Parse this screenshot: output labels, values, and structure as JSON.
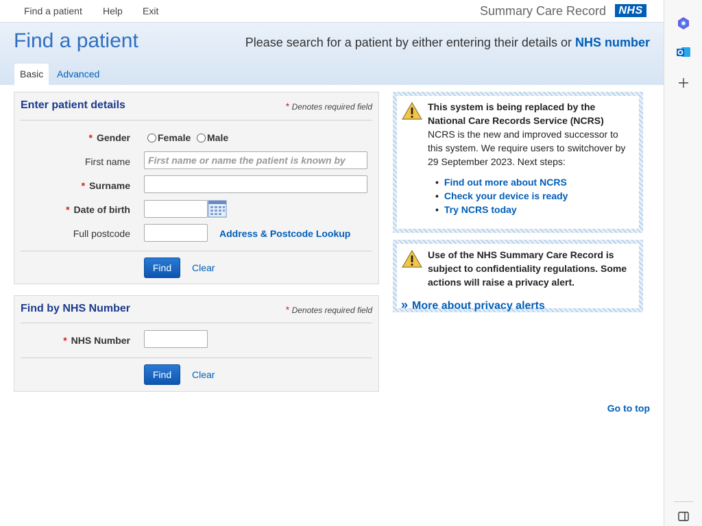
{
  "nav": {
    "find_patient": "Find a patient",
    "help": "Help",
    "exit": "Exit",
    "brand": "Summary Care Record",
    "logo_text": "NHS"
  },
  "header": {
    "title": "Find a patient",
    "intro_text": "Please search for a patient by either entering their details or",
    "intro_link": "NHS number",
    "tabs": [
      {
        "label": "Basic",
        "active": true
      },
      {
        "label": "Advanced",
        "active": false
      }
    ]
  },
  "patient_details": {
    "title": "Enter patient details",
    "required_star": "*",
    "required_note": "Denotes required field",
    "gender_label": "Gender",
    "gender_options": [
      "Female",
      "Male"
    ],
    "first_name_label": "First name",
    "first_name_placeholder": "First name or name the patient is known by",
    "surname_label": "Surname",
    "dob_label": "Date of birth",
    "postcode_label": "Full postcode",
    "address_lookup": "Address & Postcode Lookup",
    "find_label": "Find",
    "clear_label": "Clear"
  },
  "nhs_number": {
    "title": "Find by NHS Number",
    "required_note": "Denotes required field",
    "number_label": "NHS Number",
    "find_label": "Find",
    "clear_label": "Clear"
  },
  "notice_ncrs": {
    "heading_line1": "This system is being replaced by the",
    "heading_line2": "National Care Records Service (NCRS)",
    "body": "NCRS is the new and improved successor to this system. We require users to switchover by 29 September 2023. Next steps:",
    "bullet": "•",
    "links": [
      "Find out more about NCRS",
      "Check your device is ready",
      "Try NCRS today"
    ]
  },
  "notice_privacy": {
    "text": "Use of the NHS Summary Care Record is subject to confidentiality regulations. Some actions will raise a privacy alert.",
    "link": "More about privacy alerts"
  },
  "footer": {
    "go_to_top": "Go to top"
  },
  "colors": {
    "nhs_blue": "#005eb8",
    "title_blue": "#2f6fc0",
    "panel_title": "#1a3a8c",
    "required_red": "#d02020"
  },
  "side_icons": [
    "copilot-icon",
    "outlook-icon",
    "add-icon",
    "sidebar-toggle-icon"
  ]
}
